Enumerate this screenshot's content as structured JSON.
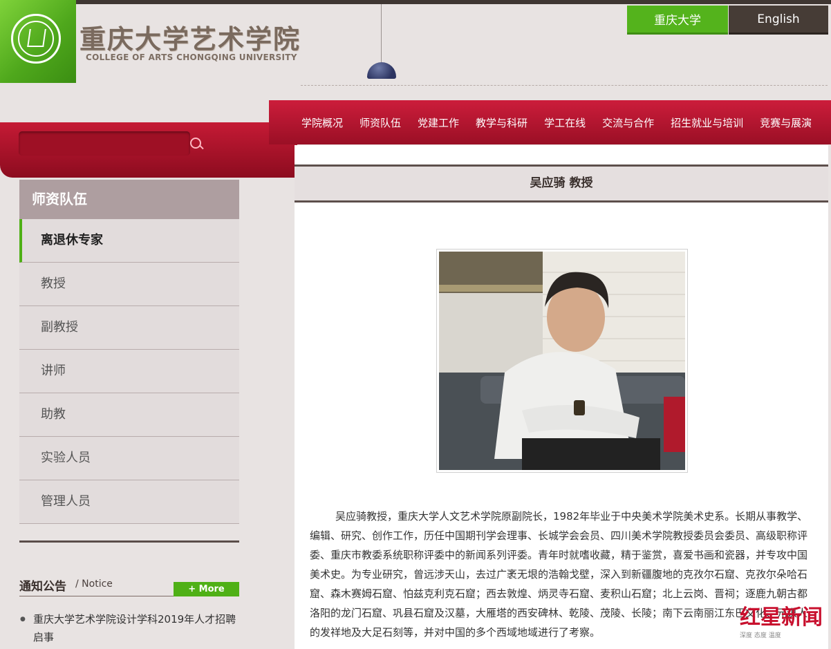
{
  "header": {
    "title_cn": "重庆大学艺术学院",
    "title_en": "COLLEGE OF ARTS CHONGQING UNIVERSITY",
    "lang_cn": "重庆大学",
    "lang_en": "English"
  },
  "nav": [
    "学院概况",
    "师资队伍",
    "党建工作",
    "教学与科研",
    "学工在线",
    "交流与合作",
    "招生就业与培训",
    "竞赛与展演"
  ],
  "search": {
    "placeholder": ""
  },
  "sidebar": {
    "heading": "师资队伍",
    "items": [
      {
        "label": "离退休专家",
        "active": true
      },
      {
        "label": "教授"
      },
      {
        "label": "副教授"
      },
      {
        "label": "讲师"
      },
      {
        "label": "助教"
      },
      {
        "label": "实验人员"
      },
      {
        "label": "管理人员"
      }
    ]
  },
  "notice": {
    "title": "通知公告",
    "subtitle": "/ Notice",
    "more": "More",
    "more_icon": "plus-icon",
    "items": [
      "重庆大学艺术学院设计学科2019年人才招聘启事"
    ]
  },
  "article": {
    "title": "吴应骑 教授",
    "bio": "吴应骑教授，重庆大学人文艺术学院原副院长，1982年毕业于中央美术学院美术史系。长期从事教学、编辑、研究、创作工作，历任中国期刊学会理事、长城学会会员、四川美术学院教授委员会委员、高级职称评委、重庆市教委系统职称评委中的新闻系列评委。青年时就嗜收藏，精于鉴赏，喜爱书画和瓷器，并专攻中国美术史。为专业研究，曾远涉天山，去过广袤无垠的浩翰戈壁，深入到新疆腹地的克孜尔石窟、克孜尔朵哈石窟、森木赛姆石窟、怕兹克利克石窟；西去敦煌、炳灵寺石窟、麦积山石窟；北上云岗、晋祠；逐鹿九朝古都洛阳的龙门石窟、巩县石窟及汉墓，大雁塔的西安碑林、乾陵、茂陵、长陵；南下云南丽江东巴文化、元谋人的发祥地及大足石刻等，并对中国的多个西域地域进行了考察。"
  },
  "watermark": {
    "text": "红星新闻",
    "sub": "深度 态度 温度"
  },
  "colors": {
    "green": "#54b31c",
    "red": "#b8142f",
    "dark": "#463c36"
  }
}
